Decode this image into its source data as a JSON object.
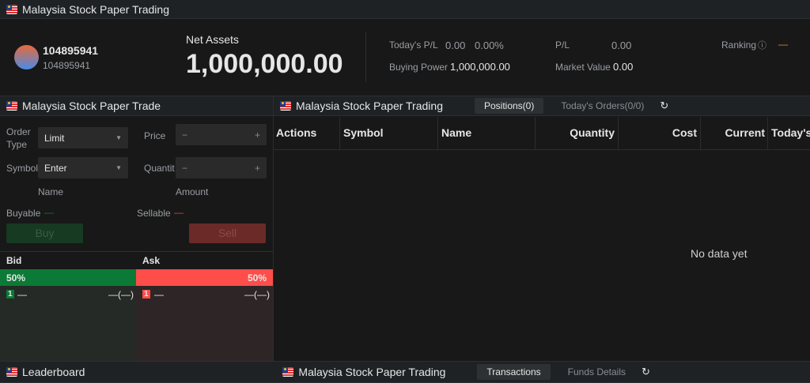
{
  "app": {
    "title": "Malaysia Stock Paper Trading"
  },
  "account": {
    "name": "104895941",
    "id": "104895941",
    "net_assets_label": "Net Assets",
    "net_assets": "1,000,000.00",
    "todays_pl_label": "Today's P/L",
    "todays_pl": "0.00",
    "todays_pl_pct": "0.00%",
    "pl_label": "P/L",
    "pl": "0.00",
    "ranking_label": "Ranking",
    "ranking": "—",
    "buying_power_label": "Buying Power",
    "buying_power": "1,000,000.00",
    "market_value_label": "Market Value",
    "market_value": "0.00"
  },
  "trade": {
    "title": "Malaysia Stock Paper Trade",
    "order_type_label": "Order Type",
    "order_type": "Limit",
    "price_label": "Price",
    "symbol_label": "Symbol",
    "symbol_value": "Enter",
    "quantity_label": "Quantit",
    "name_label": "Name",
    "amount_label": "Amount",
    "buyable_label": "Buyable",
    "buyable": "—",
    "sellable_label": "Sellable",
    "sellable": "—",
    "buy": "Buy",
    "sell": "Sell",
    "minus": "−",
    "plus": "+"
  },
  "book": {
    "bid_label": "Bid",
    "ask_label": "Ask",
    "bid_pct": "50%",
    "ask_pct": "50%",
    "bid_level": "1",
    "ask_level": "1",
    "bid_price": "—",
    "bid_vol": "—(—)",
    "ask_price": "—",
    "ask_vol": "—(—)",
    "colors": {
      "bid": "#0b7a36",
      "ask": "#ff4d4a"
    }
  },
  "positions": {
    "title": "Malaysia Stock Paper Trading",
    "tabs": [
      "Positions(0)",
      "Today's Orders(0/0)"
    ],
    "columns": [
      "Actions",
      "Symbol",
      "Name",
      "Quantity",
      "Cost",
      "Current",
      "Today's"
    ],
    "empty": "No data yet"
  },
  "bottom": {
    "leaderboard": "Leaderboard",
    "title": "Malaysia Stock Paper Trading",
    "tabs": [
      "Transactions",
      "Funds Details"
    ]
  }
}
